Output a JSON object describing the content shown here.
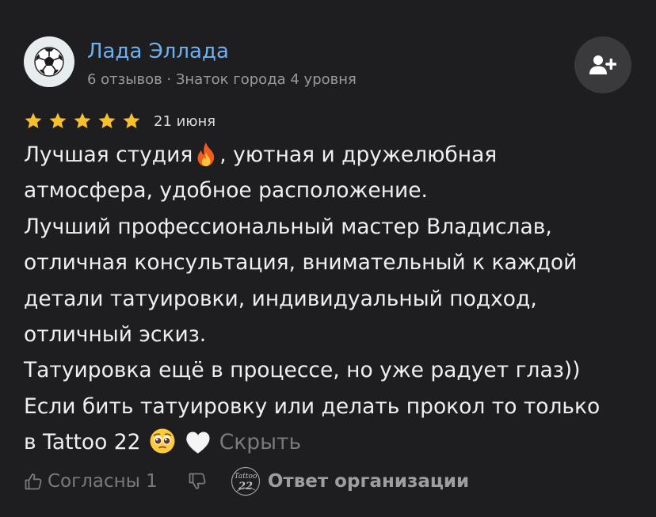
{
  "author": {
    "name": "Лада Эллада",
    "meta": "6 отзывов · Знаток города 4 уровня",
    "avatar_icon": "soccer-ball-icon"
  },
  "follow_button": {
    "icon": "add-user-icon"
  },
  "rating": {
    "stars": 5,
    "max": 5,
    "date": "21 июня",
    "star_color": "#f8c12c"
  },
  "review": {
    "line1_before": "Лучшая студия",
    "line1_after": ", уютная и дружелюбная",
    "line2": "атмосфера, удобное расположение.",
    "line3": "Лучший профессиональный мастер Владислав,",
    "line4": "отличная консультация, внимательный к каждой",
    "line5": "детали татуировки, индивидуальный подход,",
    "line6": "отличный эскиз.",
    "line7": "Татуировка ещё в процессе, но уже радует глаз))",
    "line8": "Если бить татуировку или делать прокол то только",
    "line9": "в Tattoo 22",
    "hide_label": "Скрыть"
  },
  "actions": {
    "like_label": "Согласны 1",
    "org_reply_label": "Ответ организации",
    "org_logo_text": "Tattoo 22"
  },
  "colors": {
    "background": "#1e1e20",
    "author_name": "#6fb1f0",
    "muted_text": "#7a7a7e"
  }
}
